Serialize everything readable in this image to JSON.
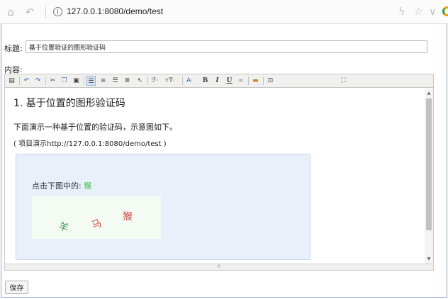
{
  "browser": {
    "url": "127.0.0.1:8080/demo/test",
    "icons": {
      "home": "home-icon",
      "back": "undo-icon",
      "site": "globe-icon",
      "lightning": "lightning-icon",
      "favorite": "star-icon",
      "menu": "chevron-down-icon"
    }
  },
  "form": {
    "title_label": "标题:",
    "title_value": "基于位置验证的图形验证码",
    "content_label": "内容:",
    "save_label": "保存"
  },
  "toolbar": {
    "font_size": "ℱ·",
    "text_size": "ᴛT·",
    "font_color": "A·",
    "bold": "B",
    "italic": "I",
    "underline": "U"
  },
  "document": {
    "heading": "1.    基于位置的图形验证码",
    "intro": "下面演示一种基于位置的验证码，示意图如下。",
    "demo_link": "( 项目演示http://127.0.0.1:8080/demo/test  )",
    "prompt": "点击下图中的: ",
    "prompt_target": "猴",
    "captcha_chars": [
      "羊",
      "马",
      "猴"
    ]
  },
  "colors": {
    "prompt_target": "#3fbf3f",
    "captcha_1": "#4a9b5a",
    "captcha_2": "#e05050",
    "captcha_3": "#d04040",
    "demo_box_bg": "#e9f0fa"
  }
}
